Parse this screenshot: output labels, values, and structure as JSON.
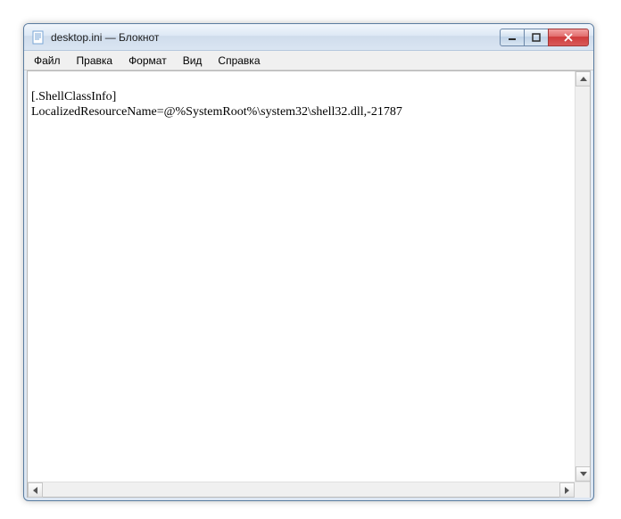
{
  "window": {
    "title": "desktop.ini — Блокнот"
  },
  "menu": {
    "file": "Файл",
    "edit": "Правка",
    "format": "Формат",
    "view": "Вид",
    "help": "Справка"
  },
  "editor": {
    "content": "\n[.ShellClassInfo]\nLocalizedResourceName=@%SystemRoot%\\system32\\shell32.dll,-21787"
  }
}
